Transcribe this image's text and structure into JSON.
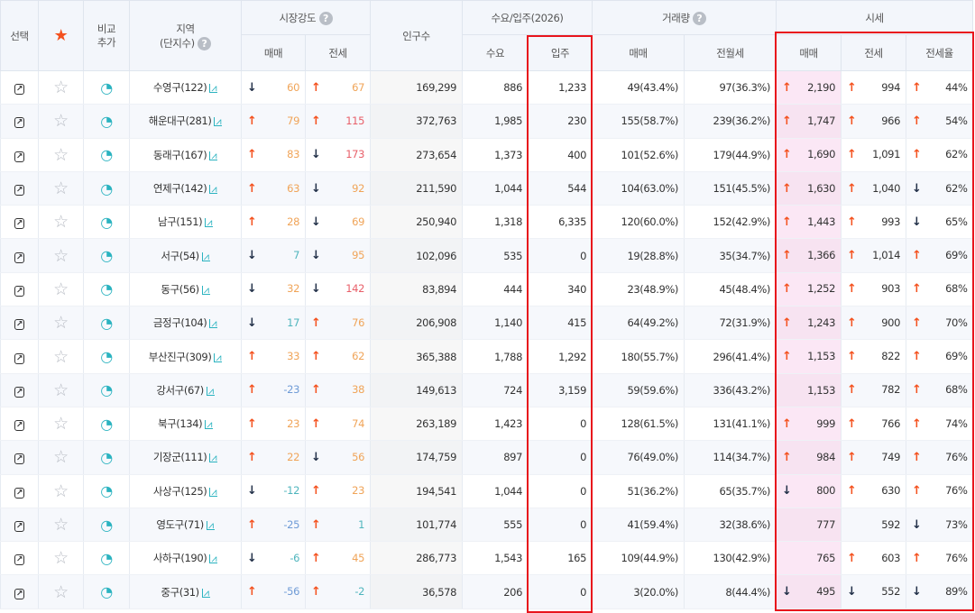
{
  "header": {
    "select": "선택",
    "compare": "비교\n추가",
    "region": "지역",
    "region_sub": "(단지수)",
    "market": "시장강도",
    "population": "인구수",
    "supply": "수요/입주(2026)",
    "trade": "거래량",
    "price": "시세",
    "sub": {
      "m_sale": "매매",
      "m_jeonse": "전세",
      "demand": "수요",
      "move_in": "입주",
      "t_sale": "매매",
      "t_rent": "전월세",
      "p_sale": "매매",
      "p_jeonse": "전세",
      "p_ratio": "전세율"
    }
  },
  "accent": {
    "highlight_box": "#e8141c",
    "star": "#f4511e",
    "up": "#f4511e",
    "down": "#223048"
  },
  "rows": [
    {
      "region": "수영구(122)",
      "ms": [
        "dn",
        "60",
        "o"
      ],
      "mj": [
        "up",
        "67",
        "o"
      ],
      "pop": "169,299",
      "demand": "886",
      "move": "1,233",
      "ts": "49(43.4%)",
      "tr": "97(36.3%)",
      "ps": [
        "up",
        "2,190"
      ],
      "pj": [
        "up",
        "994"
      ],
      "pr": [
        "up",
        "44%"
      ]
    },
    {
      "region": "해운대구(281)",
      "ms": [
        "up",
        "79",
        "o"
      ],
      "mj": [
        "up",
        "115",
        "r"
      ],
      "pop": "372,763",
      "demand": "1,985",
      "move": "230",
      "ts": "155(58.7%)",
      "tr": "239(36.2%)",
      "ps": [
        "up",
        "1,747"
      ],
      "pj": [
        "up",
        "966"
      ],
      "pr": [
        "up",
        "54%"
      ]
    },
    {
      "region": "동래구(167)",
      "ms": [
        "up",
        "83",
        "o"
      ],
      "mj": [
        "dn",
        "173",
        "r"
      ],
      "pop": "273,654",
      "demand": "1,373",
      "move": "400",
      "ts": "101(52.6%)",
      "tr": "179(44.9%)",
      "ps": [
        "up",
        "1,690"
      ],
      "pj": [
        "up",
        "1,091"
      ],
      "pr": [
        "up",
        "62%"
      ]
    },
    {
      "region": "연제구(142)",
      "ms": [
        "up",
        "63",
        "o"
      ],
      "mj": [
        "dn",
        "92",
        "o"
      ],
      "pop": "211,590",
      "demand": "1,044",
      "move": "544",
      "ts": "104(63.0%)",
      "tr": "151(45.5%)",
      "ps": [
        "up",
        "1,630"
      ],
      "pj": [
        "up",
        "1,040"
      ],
      "pr": [
        "dn",
        "62%"
      ]
    },
    {
      "region": "남구(151)",
      "ms": [
        "up",
        "28",
        "o"
      ],
      "mj": [
        "dn",
        "69",
        "o"
      ],
      "pop": "250,940",
      "demand": "1,318",
      "move": "6,335",
      "ts": "120(60.0%)",
      "tr": "152(42.9%)",
      "ps": [
        "up",
        "1,443"
      ],
      "pj": [
        "up",
        "993"
      ],
      "pr": [
        "dn",
        "65%"
      ]
    },
    {
      "region": "서구(54)",
      "ms": [
        "dn",
        "7",
        "t"
      ],
      "mj": [
        "dn",
        "95",
        "o"
      ],
      "pop": "102,096",
      "demand": "535",
      "move": "0",
      "ts": "19(28.8%)",
      "tr": "35(34.7%)",
      "ps": [
        "up",
        "1,366"
      ],
      "pj": [
        "up",
        "1,014"
      ],
      "pr": [
        "up",
        "69%"
      ]
    },
    {
      "region": "동구(56)",
      "ms": [
        "dn",
        "32",
        "o"
      ],
      "mj": [
        "dn",
        "142",
        "r"
      ],
      "pop": "83,894",
      "demand": "444",
      "move": "340",
      "ts": "23(48.9%)",
      "tr": "45(48.4%)",
      "ps": [
        "up",
        "1,252"
      ],
      "pj": [
        "up",
        "903"
      ],
      "pr": [
        "up",
        "68%"
      ]
    },
    {
      "region": "금정구(104)",
      "ms": [
        "dn",
        "17",
        "t"
      ],
      "mj": [
        "up",
        "76",
        "o"
      ],
      "pop": "206,908",
      "demand": "1,140",
      "move": "415",
      "ts": "64(49.2%)",
      "tr": "72(31.9%)",
      "ps": [
        "up",
        "1,243"
      ],
      "pj": [
        "up",
        "900"
      ],
      "pr": [
        "up",
        "70%"
      ]
    },
    {
      "region": "부산진구(309)",
      "ms": [
        "up",
        "33",
        "o"
      ],
      "mj": [
        "up",
        "62",
        "o"
      ],
      "pop": "365,388",
      "demand": "1,788",
      "move": "1,292",
      "ts": "180(55.7%)",
      "tr": "296(41.4%)",
      "ps": [
        "up",
        "1,153"
      ],
      "pj": [
        "up",
        "822"
      ],
      "pr": [
        "up",
        "69%"
      ]
    },
    {
      "region": "강서구(67)",
      "ms": [
        "up",
        "-23",
        "b"
      ],
      "mj": [
        "up",
        "38",
        "o"
      ],
      "pop": "149,613",
      "demand": "724",
      "move": "3,159",
      "ts": "59(59.6%)",
      "tr": "336(43.2%)",
      "ps": [
        "",
        "1,153"
      ],
      "pj": [
        "up",
        "782"
      ],
      "pr": [
        "up",
        "68%"
      ]
    },
    {
      "region": "북구(134)",
      "ms": [
        "up",
        "23",
        "o"
      ],
      "mj": [
        "up",
        "74",
        "o"
      ],
      "pop": "263,189",
      "demand": "1,423",
      "move": "0",
      "ts": "128(61.5%)",
      "tr": "131(41.1%)",
      "ps": [
        "up",
        "999"
      ],
      "pj": [
        "up",
        "766"
      ],
      "pr": [
        "up",
        "74%"
      ]
    },
    {
      "region": "기장군(111)",
      "ms": [
        "up",
        "22",
        "o"
      ],
      "mj": [
        "dn",
        "56",
        "o"
      ],
      "pop": "174,759",
      "demand": "897",
      "move": "0",
      "ts": "76(49.0%)",
      "tr": "114(34.7%)",
      "ps": [
        "up",
        "984"
      ],
      "pj": [
        "up",
        "749"
      ],
      "pr": [
        "up",
        "76%"
      ]
    },
    {
      "region": "사상구(125)",
      "ms": [
        "dn",
        "-12",
        "t"
      ],
      "mj": [
        "up",
        "23",
        "o"
      ],
      "pop": "194,541",
      "demand": "1,044",
      "move": "0",
      "ts": "51(36.2%)",
      "tr": "65(35.7%)",
      "ps": [
        "dn",
        "800"
      ],
      "pj": [
        "up",
        "630"
      ],
      "pr": [
        "up",
        "76%"
      ]
    },
    {
      "region": "영도구(71)",
      "ms": [
        "up",
        "-25",
        "b"
      ],
      "mj": [
        "up",
        "1",
        "t"
      ],
      "pop": "101,774",
      "demand": "555",
      "move": "0",
      "ts": "41(59.4%)",
      "tr": "32(38.6%)",
      "ps": [
        "",
        "777"
      ],
      "pj": [
        "",
        "592"
      ],
      "pr": [
        "dn",
        "73%"
      ]
    },
    {
      "region": "사하구(190)",
      "ms": [
        "dn",
        "-6",
        "t"
      ],
      "mj": [
        "up",
        "45",
        "o"
      ],
      "pop": "286,773",
      "demand": "1,543",
      "move": "165",
      "ts": "109(44.9%)",
      "tr": "130(42.9%)",
      "ps": [
        "",
        "765"
      ],
      "pj": [
        "up",
        "603"
      ],
      "pr": [
        "up",
        "76%"
      ]
    },
    {
      "region": "중구(31)",
      "ms": [
        "up",
        "-56",
        "b"
      ],
      "mj": [
        "up",
        "-2",
        "t"
      ],
      "pop": "36,578",
      "demand": "206",
      "move": "0",
      "ts": "3(20.0%)",
      "tr": "8(44.4%)",
      "ps": [
        "dn",
        "495"
      ],
      "pj": [
        "dn",
        "552"
      ],
      "pr": [
        "dn",
        "89%"
      ]
    }
  ]
}
